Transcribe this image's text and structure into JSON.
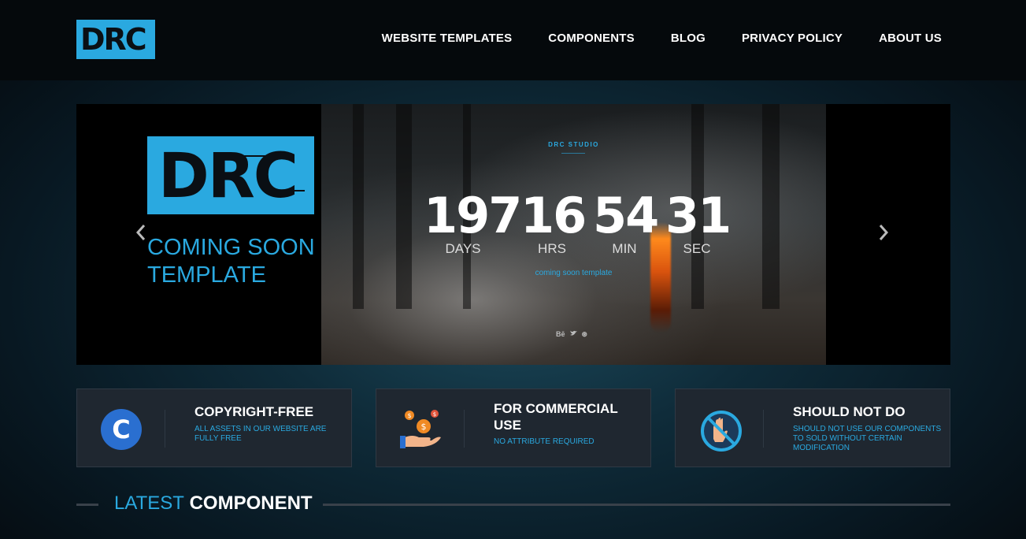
{
  "header": {
    "logo_text": "DRC",
    "nav": [
      {
        "label": "WEBSITE TEMPLATES"
      },
      {
        "label": "COMPONENTS"
      },
      {
        "label": "BLOG"
      },
      {
        "label": "PRIVACY POLICY"
      },
      {
        "label": "ABOUT US"
      }
    ]
  },
  "carousel": {
    "slide_logo_text": "DRC",
    "slide_title": "COMING SOON TEMPLATE",
    "prev_icon": "chevron-left-icon",
    "next_icon": "chevron-right-icon",
    "preview": {
      "studio_label": "DRC STUDIO",
      "countdown": [
        {
          "value": "197",
          "label": "DAYS"
        },
        {
          "value": "16",
          "label": "HRS"
        },
        {
          "value": "54",
          "label": "MIN"
        },
        {
          "value": "31",
          "label": "SEC"
        }
      ],
      "subtitle": "coming soon template",
      "social": [
        "Bē",
        "🐦",
        "⊛"
      ]
    }
  },
  "features": [
    {
      "title": "COPYRIGHT-FREE",
      "desc": "ALL ASSETS IN OUR WEBSITE ARE FULLY FREE",
      "icon": "copyright-c-icon",
      "icon_glyph": "C"
    },
    {
      "title": "FOR COMMERCIAL USE",
      "desc": "NO ATTRIBUTE REQUIRED",
      "icon": "hand-coins-icon"
    },
    {
      "title": "SHOULD NOT DO",
      "desc": "SHOULD NOT USE OUR COMPONENTS TO SOLD WITHOUT CERTAIN MODIFICATION",
      "icon": "no-hand-icon"
    }
  ],
  "latest": {
    "accent": "LATEST",
    "rest": "COMPONENT"
  },
  "colors": {
    "accent": "#2aa9e0",
    "card_bg": "#1f2730",
    "header_bg": "#05090c"
  }
}
